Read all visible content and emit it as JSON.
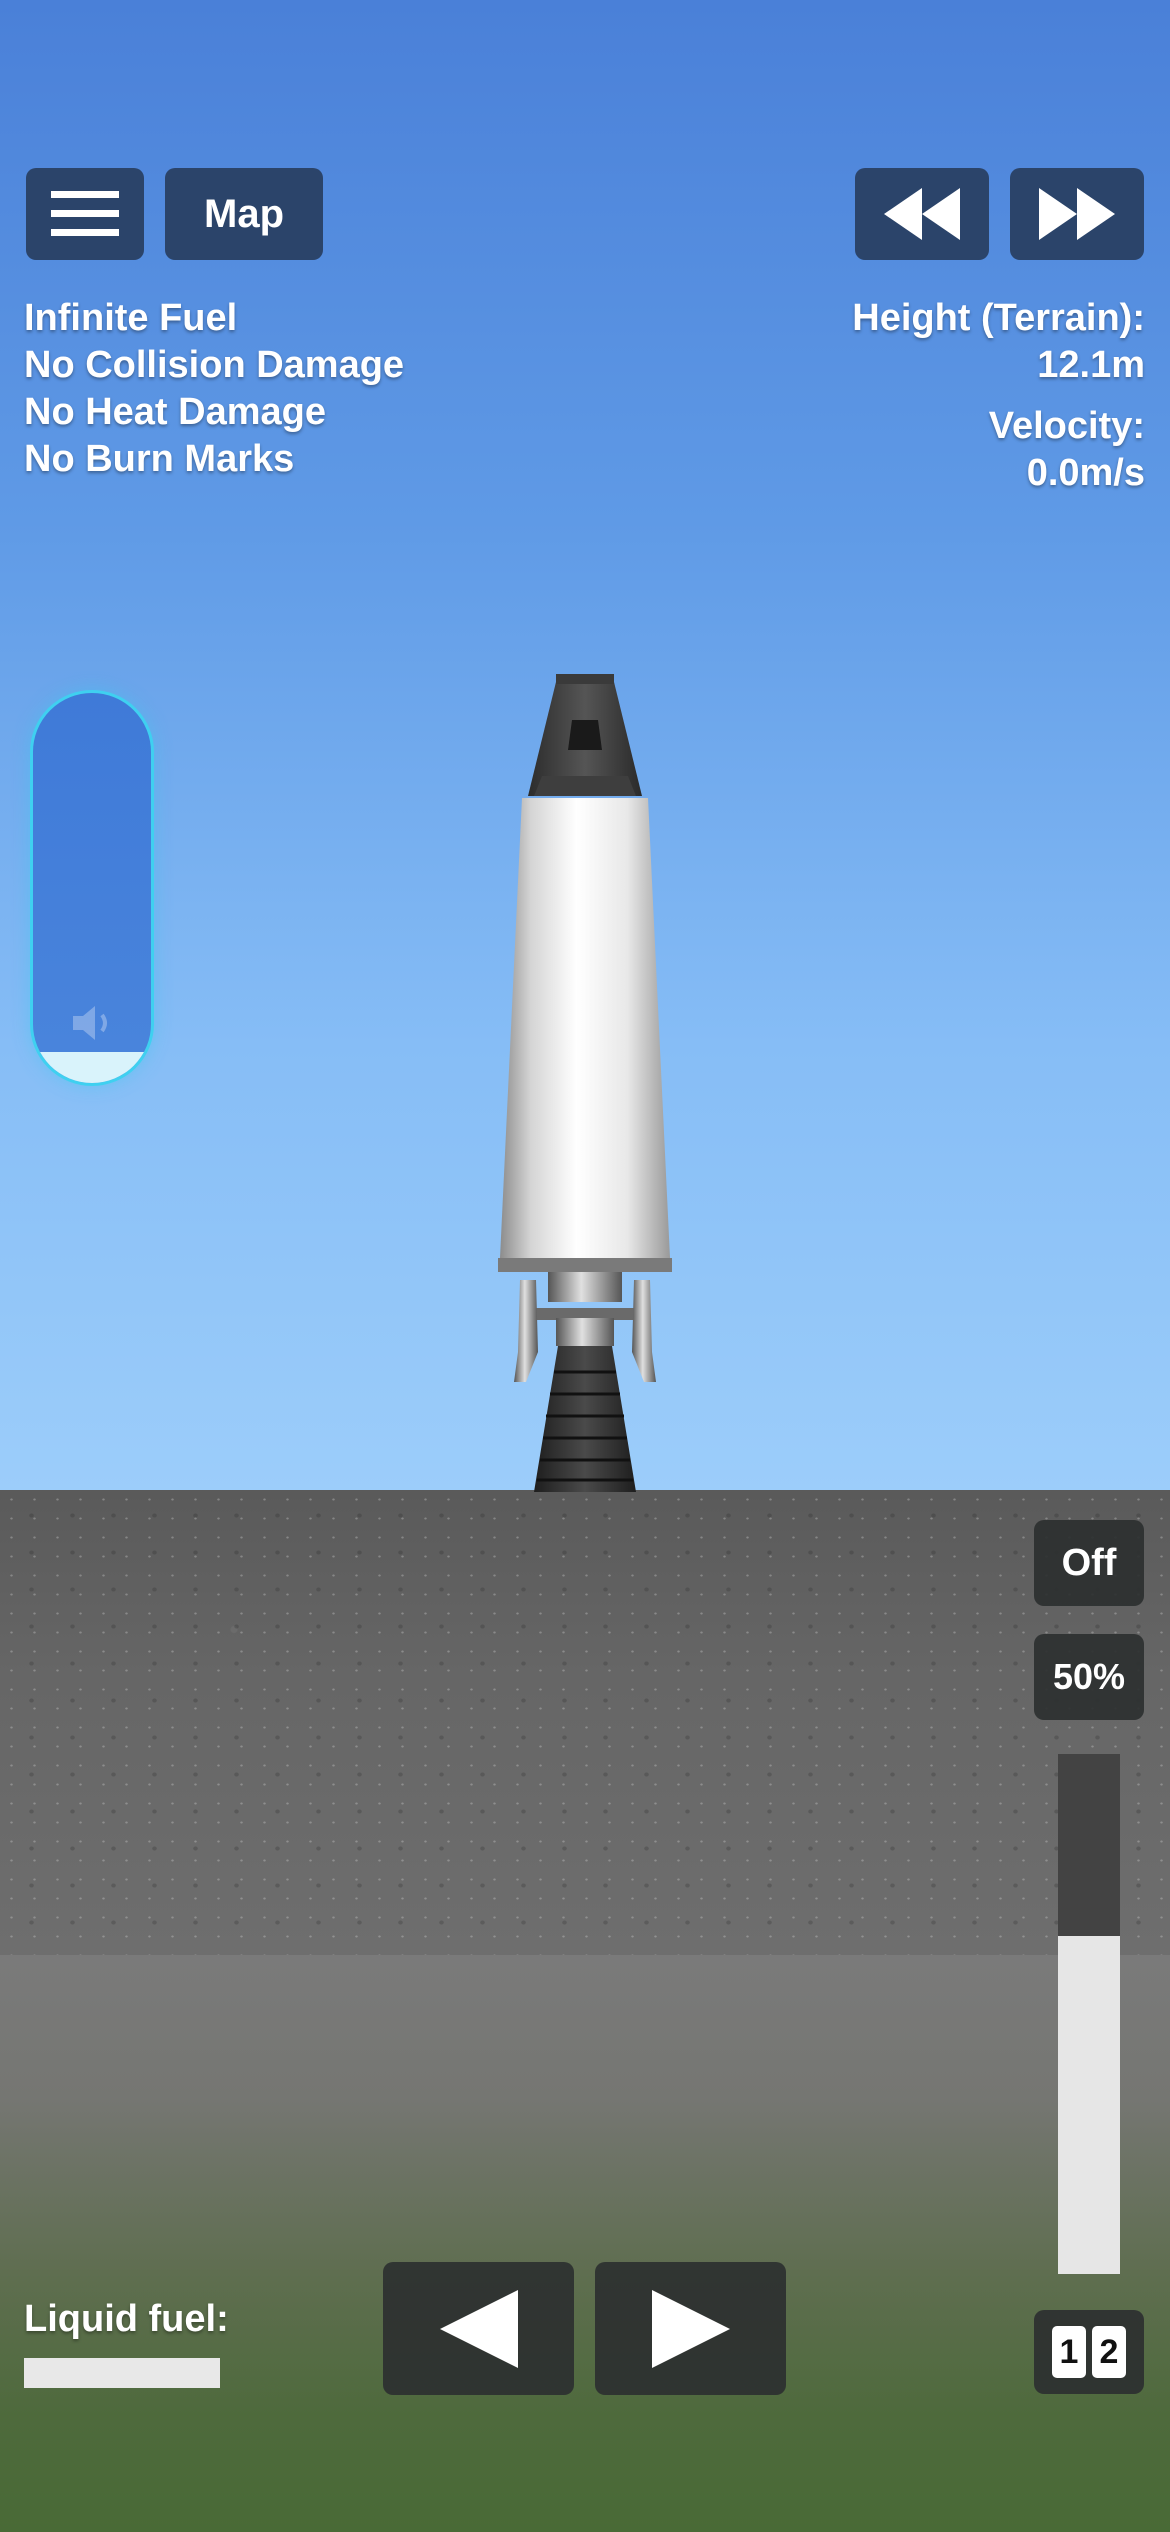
{
  "toolbar": {
    "menu_icon": "hamburger-menu-icon",
    "map_label": "Map",
    "rewind_icon": "rewind-icon",
    "fast_forward_icon": "fast-forward-icon"
  },
  "cheats": {
    "items": [
      "Infinite Fuel",
      "No Collision Damage",
      "No Heat Damage",
      "No Burn Marks"
    ]
  },
  "telemetry": {
    "height_label": "Height (Terrain):",
    "height_value": "12.1m",
    "velocity_label": "Velocity:",
    "velocity_value": "0.0m/s"
  },
  "volume": {
    "icon": "speaker-icon",
    "level": 0.08
  },
  "controls": {
    "auto_label": "Off",
    "throttle_label": "50%",
    "throttle_level": 0.65,
    "rotate_left_icon": "rotate-left-icon",
    "rotate_right_icon": "rotate-right-icon"
  },
  "fuel": {
    "label": "Liquid fuel:",
    "level": 1.0
  },
  "stages": [
    "1",
    "2"
  ],
  "colors": {
    "sky": "#5f9ae6",
    "ground": "#666666",
    "button": "#283e5f",
    "volume_border": "#3fd0f0"
  }
}
